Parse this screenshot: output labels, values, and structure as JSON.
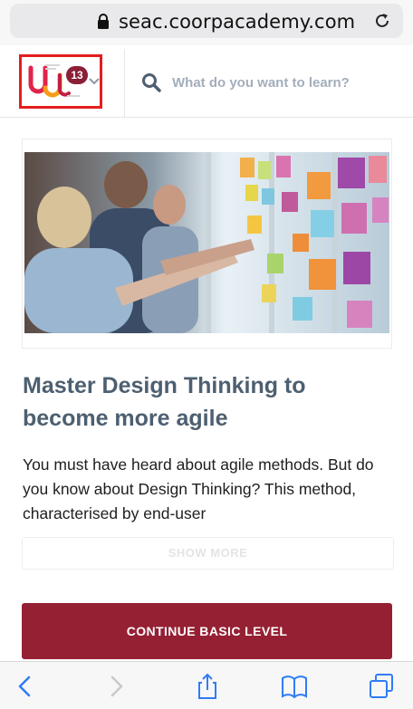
{
  "browser": {
    "url": "seac.coorpacademy.com",
    "icons": {
      "lock": "lock-icon",
      "reload": "reload-icon"
    }
  },
  "header": {
    "logo_badge_count": "13",
    "search_placeholder": "What do you want to learn?"
  },
  "course": {
    "title": "Master Design Thinking to become more agile",
    "description": "You must have heard about agile methods. But do you know about Design Thinking? This method, characterised by end-user",
    "show_more_label": "SHOW MORE",
    "continue_label": "CONTINUE BASIC LEVEL"
  },
  "toolbar": {
    "icons": [
      "back-icon",
      "forward-icon",
      "share-icon",
      "bookmarks-icon",
      "tabs-icon"
    ]
  },
  "colors": {
    "accent": "#952033",
    "title": "#4d5f70",
    "link_blue": "#2f7cf6",
    "highlight_box": "#e41d1d"
  }
}
